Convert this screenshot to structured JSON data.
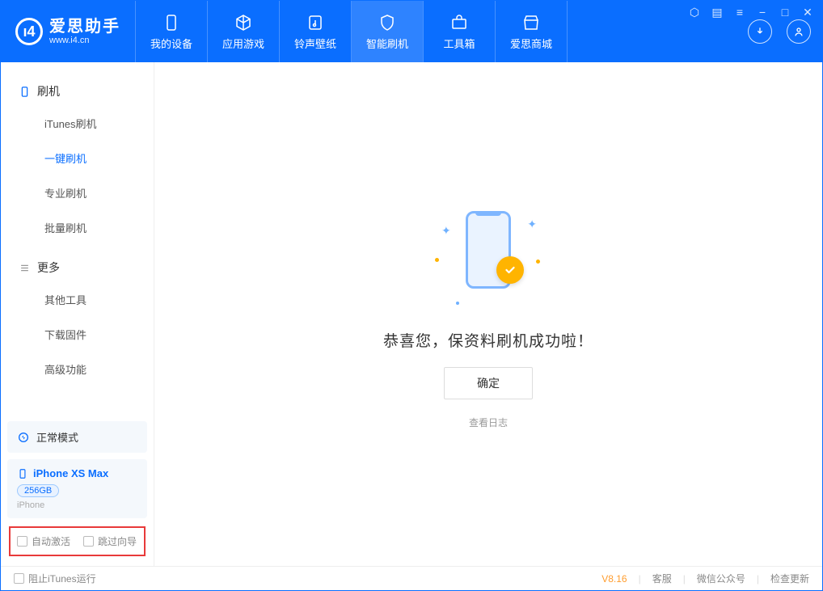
{
  "app": {
    "title": "爱思助手",
    "subtitle": "www.i4.cn"
  },
  "nav": {
    "tabs": [
      {
        "label": "我的设备"
      },
      {
        "label": "应用游戏"
      },
      {
        "label": "铃声壁纸"
      },
      {
        "label": "智能刷机"
      },
      {
        "label": "工具箱"
      },
      {
        "label": "爱思商城"
      }
    ]
  },
  "sidebar": {
    "section1": {
      "title": "刷机",
      "items": [
        "iTunes刷机",
        "一键刷机",
        "专业刷机",
        "批量刷机"
      ]
    },
    "section2": {
      "title": "更多",
      "items": [
        "其他工具",
        "下载固件",
        "高级功能"
      ]
    },
    "mode": "正常模式",
    "device": {
      "name": "iPhone XS Max",
      "storage": "256GB",
      "type": "iPhone"
    },
    "checks": {
      "auto_activate": "自动激活",
      "skip_guide": "跳过向导"
    }
  },
  "main": {
    "success_text": "恭喜您，保资料刷机成功啦！",
    "confirm_label": "确定",
    "view_log": "查看日志"
  },
  "footer": {
    "block_itunes": "阻止iTunes运行",
    "version": "V8.16",
    "links": [
      "客服",
      "微信公众号",
      "检查更新"
    ]
  }
}
